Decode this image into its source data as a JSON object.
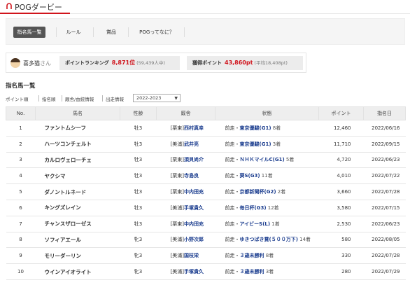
{
  "header": {
    "title": "POGダービー",
    "icon": "horseshoe-icon",
    "accent": "#d0141c"
  },
  "tabs": [
    {
      "label": "指名馬一覧",
      "active": true
    },
    {
      "label": "ルール",
      "active": false
    },
    {
      "label": "賞品",
      "active": false
    },
    {
      "label": "POGってなに？",
      "active": false
    }
  ],
  "user": {
    "name": "喜多猫",
    "suffix": "さん",
    "ranking_label": "ポイントランキング",
    "ranking_value": "8,871位",
    "ranking_sub": "(59,439人中)",
    "points_label": "獲得ポイント",
    "points_value": "43,860pt",
    "points_sub": "(平均18,408pt)"
  },
  "section_title": "指名馬一覧",
  "filters": [
    "ポイント順",
    "指名順",
    "厩舎/血統情報",
    "出走情報"
  ],
  "season": "2022-2023",
  "table": {
    "headers": [
      "No.",
      "馬名",
      "性齢",
      "厩舎",
      "状態",
      "ポイント",
      "指名日"
    ],
    "rows": [
      {
        "no": "1",
        "name": "ファントムシーフ",
        "sex": "牡3",
        "region": "[栗東]",
        "trainer": "西村真幸",
        "prefix": "前走・",
        "race": "東京優駿(G1)",
        "rank": "8着",
        "points": "12,460",
        "date": "2022/06/16"
      },
      {
        "no": "2",
        "name": "ハーツコンチェルト",
        "sex": "牡3",
        "region": "[美浦]",
        "trainer": "武井亮",
        "prefix": "前走・",
        "race": "東京優駿(G1)",
        "rank": "3着",
        "points": "11,710",
        "date": "2022/09/15"
      },
      {
        "no": "3",
        "name": "カルロヴェローチェ",
        "sex": "牡3",
        "region": "[栗東]",
        "trainer": "須貝尚介",
        "prefix": "前走・",
        "race": "ＮＨＫマイルC(G1)",
        "rank": "5着",
        "points": "4,720",
        "date": "2022/06/23"
      },
      {
        "no": "4",
        "name": "ヤクシマ",
        "sex": "牡3",
        "region": "[栗東]",
        "trainer": "寺島良",
        "prefix": "前走・",
        "race": "葵S(G3)",
        "rank": "11着",
        "points": "4,010",
        "date": "2022/07/22"
      },
      {
        "no": "5",
        "name": "ダノントルネード",
        "sex": "牡3",
        "region": "[栗東]",
        "trainer": "中内田充",
        "prefix": "前走・",
        "race": "京都新聞杯(G2)",
        "rank": "2着",
        "points": "3,660",
        "date": "2022/07/28"
      },
      {
        "no": "6",
        "name": "キングズレイン",
        "sex": "牡3",
        "region": "[美浦]",
        "trainer": "手塚貴久",
        "prefix": "前走・",
        "race": "毎日杯(G3)",
        "rank": "12着",
        "points": "3,580",
        "date": "2022/07/15"
      },
      {
        "no": "7",
        "name": "チャンスザローゼス",
        "sex": "牡3",
        "region": "[栗東]",
        "trainer": "中内田充",
        "prefix": "前走・",
        "race": "アイビーS(L)",
        "rank": "1着",
        "points": "2,530",
        "date": "2022/06/23"
      },
      {
        "no": "8",
        "name": "ソフィアエール",
        "sex": "牝3",
        "region": "[美浦]",
        "trainer": "小野次郎",
        "prefix": "前走・",
        "race": "ゆきつばき賞(５００万下)",
        "rank": "14着",
        "points": "580",
        "date": "2022/08/05"
      },
      {
        "no": "9",
        "name": "モリーダーリン",
        "sex": "牝3",
        "region": "[美浦]",
        "trainer": "国枝栄",
        "prefix": "前走・",
        "race": "３歳未勝利",
        "rank": "8着",
        "points": "330",
        "date": "2022/07/28"
      },
      {
        "no": "10",
        "name": "ウインアイオライト",
        "sex": "牝3",
        "region": "[美浦]",
        "trainer": "手塚貴久",
        "prefix": "前走・",
        "race": "３歳未勝利",
        "rank": "3着",
        "points": "280",
        "date": "2022/07/29"
      }
    ]
  }
}
